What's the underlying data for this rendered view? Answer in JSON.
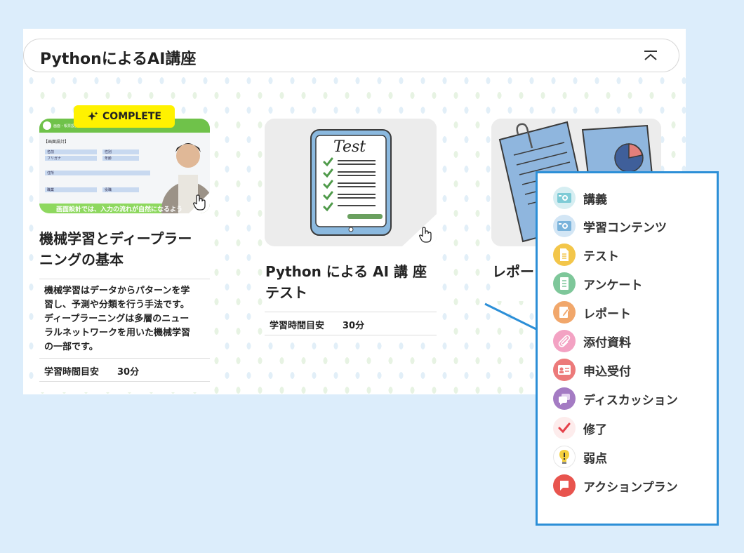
{
  "section": {
    "title": "PythonによるAI講座"
  },
  "cards": [
    {
      "badge": "COMPLETE",
      "title_line1": "機械学習とディープラー",
      "title_line2": "ニングの基本",
      "desc_lines": [
        "機械学習はデータからパターンを学",
        "習し、予測や分類を行う手法です。",
        "ディープラーニングは多層のニュー",
        "ラルネットワークを用いた機械学習",
        "の一部です。"
      ],
      "study_label": "学習時間目安",
      "study_value": "30分",
      "thumb": {
        "slide_header": "画面・帳票設計",
        "slide_section": "【画面設計】",
        "fields": [
          "名前",
          "フリガナ",
          "性別",
          "年齢",
          "住所",
          "職業",
          "役職"
        ],
        "caption": "画面設計では、入力の流れが自然になるよう"
      }
    },
    {
      "title_line1": "Python による AI 講 座",
      "title_line2": "テスト",
      "study_label": "学習時間目安",
      "study_value": "30分",
      "thumb_text": "Test"
    },
    {
      "title_line1": "レポー"
    }
  ],
  "menu": {
    "items": [
      {
        "label": "講義",
        "icon": "lecture-icon",
        "color": "#7ecbd6"
      },
      {
        "label": "学習コンテンツ",
        "icon": "content-icon",
        "color": "#7ab3db"
      },
      {
        "label": "テスト",
        "icon": "test-icon",
        "color": "#f3c64a"
      },
      {
        "label": "アンケート",
        "icon": "survey-icon",
        "color": "#7ec79a"
      },
      {
        "label": "レポート",
        "icon": "report-icon",
        "color": "#f1a76b"
      },
      {
        "label": "添付資料",
        "icon": "attachment-icon",
        "color": "#f3a2c3"
      },
      {
        "label": "申込受付",
        "icon": "application-icon",
        "color": "#ec7a7a"
      },
      {
        "label": "ディスカッション",
        "icon": "discussion-icon",
        "color": "#a47bc3"
      },
      {
        "label": "修了",
        "icon": "check-icon",
        "color": "#e5404a"
      },
      {
        "label": "弱点",
        "icon": "weakness-icon",
        "color": "#f4d03f"
      },
      {
        "label": "アクションプラン",
        "icon": "action-plan-icon",
        "color": "#e8544e"
      }
    ]
  }
}
